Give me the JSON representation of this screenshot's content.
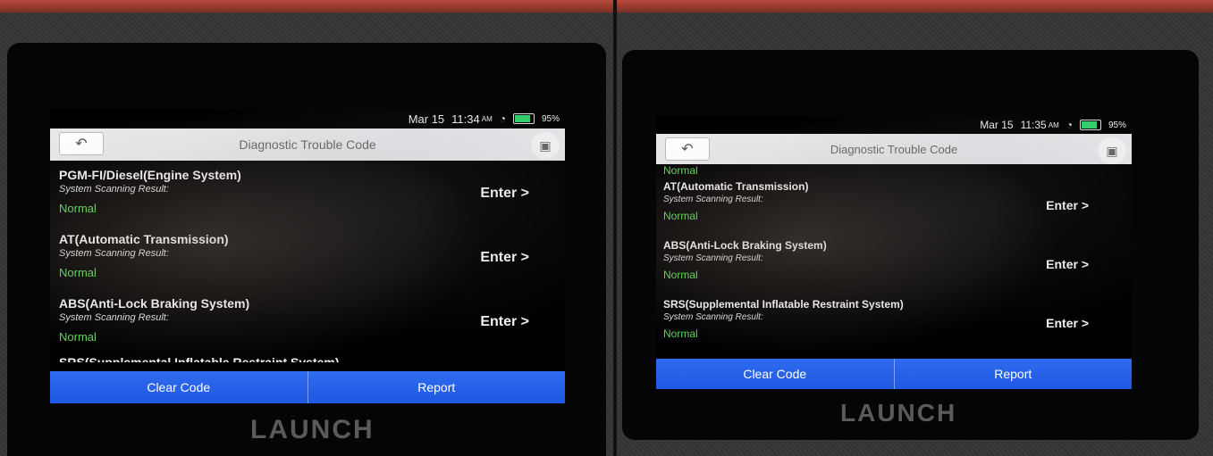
{
  "left": {
    "status": {
      "date": "Mar 15",
      "time": "11:34",
      "ampm": "AM",
      "battery": "95%"
    },
    "title": "Diagnostic Trouble Code",
    "items": [
      {
        "name": "PGM-FI/Diesel(Engine System)",
        "label": "System Scanning Result:",
        "status": "Normal",
        "action": "Enter >"
      },
      {
        "name": "AT(Automatic Transmission)",
        "label": "System Scanning Result:",
        "status": "Normal",
        "action": "Enter >"
      },
      {
        "name": "ABS(Anti-Lock Braking System)",
        "label": "System Scanning Result:",
        "status": "Normal",
        "action": "Enter >"
      }
    ],
    "partial_name": "SRS(Supplemental Inflatable Restraint System)",
    "buttons": {
      "clear": "Clear Code",
      "report": "Report"
    },
    "brand": "LAUNCH"
  },
  "right": {
    "status": {
      "date": "Mar 15",
      "time": "11:35",
      "ampm": "AM",
      "battery": "95%"
    },
    "title": "Diagnostic Trouble Code",
    "partial_status": "Normal",
    "items": [
      {
        "name": "AT(Automatic Transmission)",
        "label": "System Scanning Result:",
        "status": "Normal",
        "action": "Enter >"
      },
      {
        "name": "ABS(Anti-Lock Braking System)",
        "label": "System Scanning Result:",
        "status": "Normal",
        "action": "Enter >"
      },
      {
        "name": "SRS(Supplemental Inflatable Restraint System)",
        "label": "System Scanning Result:",
        "status": "Normal",
        "action": "Enter >"
      }
    ],
    "buttons": {
      "clear": "Clear Code",
      "report": "Report"
    },
    "brand": "LAUNCH"
  },
  "icons": {
    "back": "back-arrow-icon",
    "camera": "camera-icon",
    "wifi": "wifi-icon",
    "battery": "battery-icon"
  },
  "colors": {
    "status_normal": "#5ed35a",
    "action_bar": "#2563eb",
    "title_bar": "#e7e8ea"
  }
}
